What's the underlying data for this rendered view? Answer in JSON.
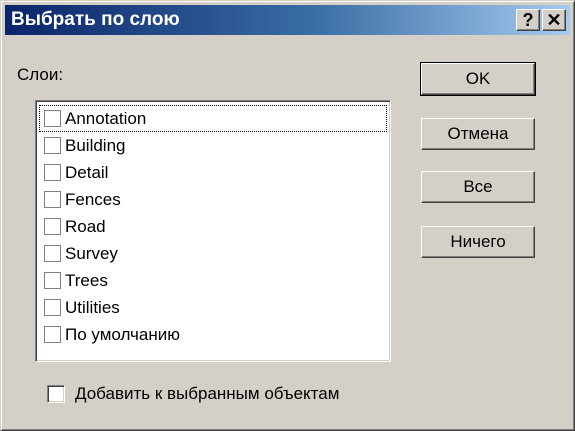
{
  "window": {
    "title": "Выбрать по слою",
    "help_glyph": "?",
    "close_glyph": "✕"
  },
  "layers_label": "Слои:",
  "layers": [
    {
      "label": "Annotation",
      "checked": false
    },
    {
      "label": "Building",
      "checked": false
    },
    {
      "label": "Detail",
      "checked": false
    },
    {
      "label": "Fences",
      "checked": false
    },
    {
      "label": "Road",
      "checked": false
    },
    {
      "label": "Survey",
      "checked": false
    },
    {
      "label": "Trees",
      "checked": false
    },
    {
      "label": "Utilities",
      "checked": false
    },
    {
      "label": "По умолчанию",
      "checked": false
    }
  ],
  "buttons": {
    "ok": "OK",
    "cancel": "Отмена",
    "all": "Все",
    "none": "Ничего"
  },
  "add_to_selection": {
    "label": "Добавить к выбранным объектам",
    "checked": false
  },
  "colors": {
    "face": "#d4d0c8",
    "title_start": "#0a246a",
    "title_end": "#a6caf0"
  }
}
